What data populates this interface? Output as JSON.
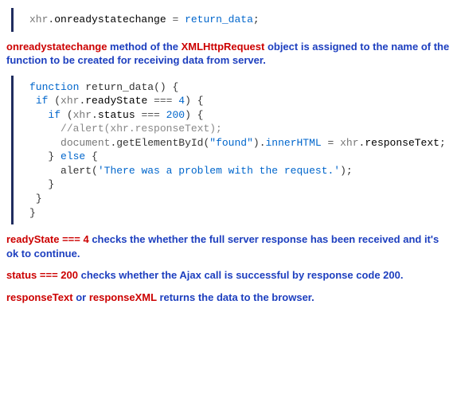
{
  "code1": {
    "xhr": "xhr",
    "dot1": ".",
    "onready": "onreadystatechange",
    "assign": " = ",
    "retdata": "return_data",
    "semi": ";"
  },
  "para1": {
    "t1": "onreadystatechange",
    "t2": " method of the ",
    "t3": "XMLHttpRequest",
    "t4": " object is assigned to the name of the function to be created for receiving data from server."
  },
  "code2": {
    "l1": {
      "kw": "function",
      "sp": " ",
      "name": "return_data",
      "rest": "() {"
    },
    "l2": {
      "sp": " ",
      "kw": "if",
      "open": " (",
      "obj": "xhr",
      "dot": ".",
      "prop": "readyState",
      "op": " === ",
      "num": "4",
      "close": ") {"
    },
    "l3": {
      "sp": "   ",
      "kw": "if",
      "open": " (",
      "obj": "xhr",
      "dot": ".",
      "prop": "status",
      "op": " === ",
      "num": "200",
      "close": ") {"
    },
    "l4": {
      "sp": "     ",
      "cmt": "//alert(xhr.responseText);"
    },
    "l5": {
      "sp": "     ",
      "obj": "document",
      "dot": ".",
      "m1": "getElementById(",
      "str": "\"found\"",
      "m2": ").",
      "inner": "innerHTML",
      "op": " = ",
      "obj2": "xhr",
      "dot2": ".",
      "rt": "responseText",
      "semi": ";"
    },
    "l6": {
      "sp": "   ",
      "close": "} ",
      "kw": "else",
      "open": " {"
    },
    "l7": {
      "sp": "     ",
      "fn": "alert",
      "open": "(",
      "str": "'There was a problem with the request.'",
      "close": ");"
    },
    "l8": {
      "sp": "   ",
      "brace": "}"
    },
    "l9": {
      "sp": " ",
      "brace": "}"
    },
    "l10": {
      "brace": "}"
    }
  },
  "para2": {
    "t1": "readyState === 4",
    "t2": " checks the whether the full server response has been received and it's ok to continue."
  },
  "para3": {
    "t1": "status === 200",
    "t2": " checks whether the Ajax call is successful by response code 200."
  },
  "para4": {
    "t1": "responseText",
    "t2": " or ",
    "t3": "responseXML",
    "t4": " returns the data to the browser."
  }
}
